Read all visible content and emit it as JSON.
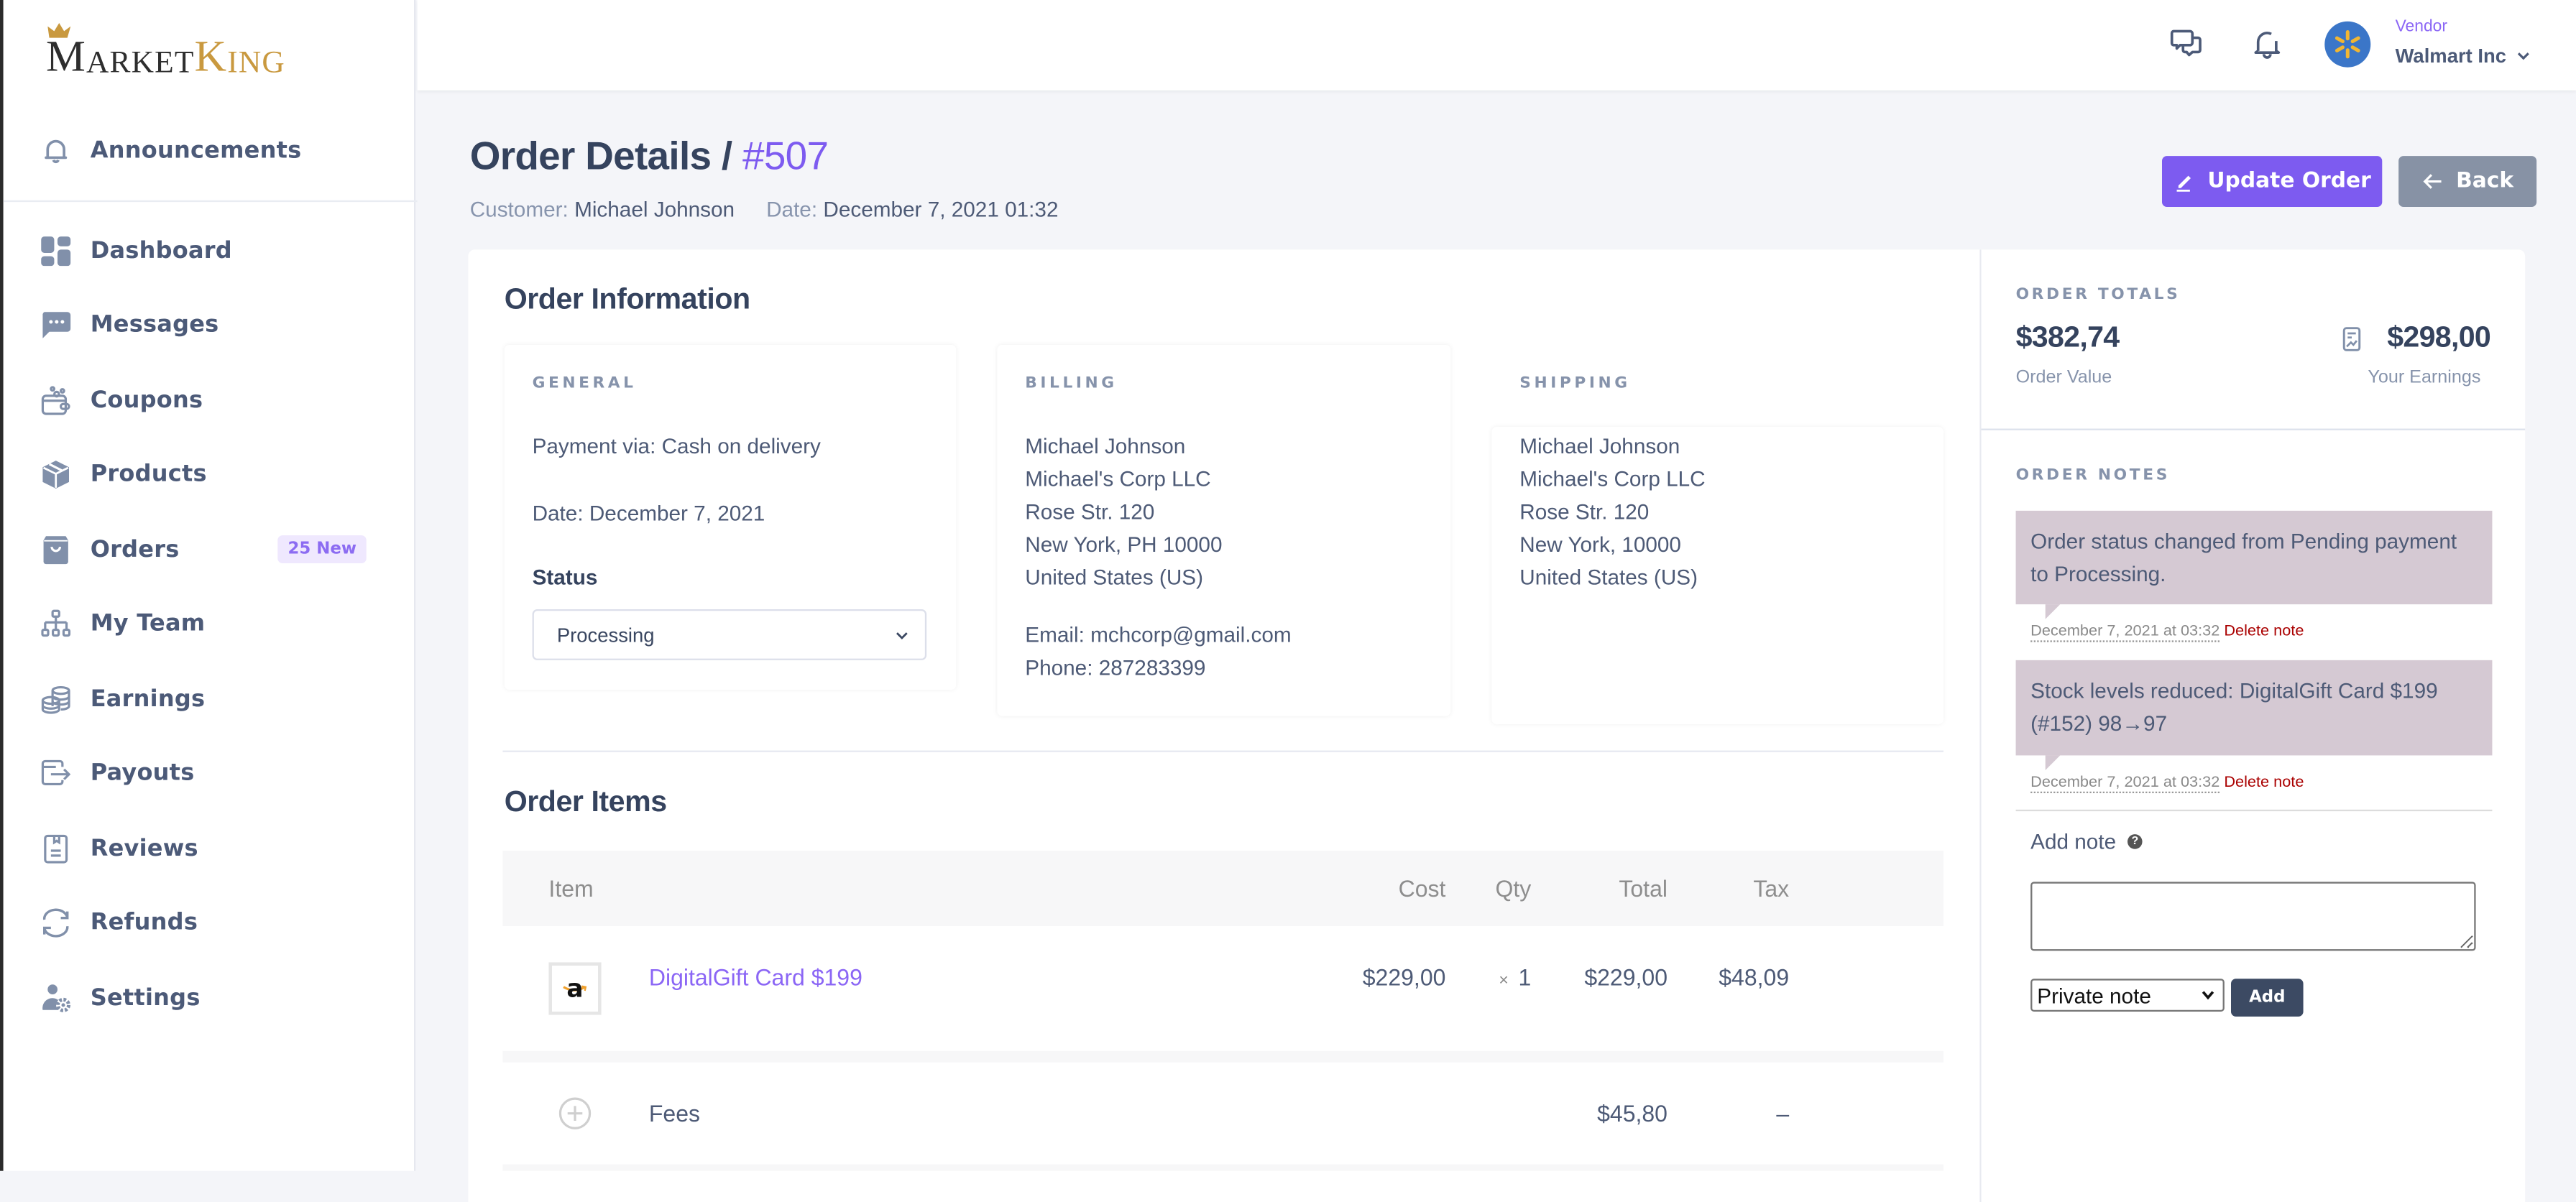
{
  "brand": {
    "logo_part1": "M",
    "logo_part2": "ARKET",
    "logo_part3": "K",
    "logo_part4": "ING"
  },
  "sidebar": {
    "announcements": {
      "label": "Announcements",
      "icon": "bell-icon"
    },
    "items": [
      {
        "label": "Dashboard",
        "icon": "dashboard-grid-icon"
      },
      {
        "label": "Messages",
        "icon": "chat-bubble-icon"
      },
      {
        "label": "Coupons",
        "icon": "coupon-wallet-icon"
      },
      {
        "label": "Products",
        "icon": "box-icon"
      },
      {
        "label": "Orders",
        "icon": "shopping-bag-icon",
        "badge": "25 New"
      },
      {
        "label": "My Team",
        "icon": "org-chart-icon"
      },
      {
        "label": "Earnings",
        "icon": "coins-icon"
      },
      {
        "label": "Payouts",
        "icon": "payout-arrow-icon"
      },
      {
        "label": "Reviews",
        "icon": "review-document-icon"
      },
      {
        "label": "Refunds",
        "icon": "refresh-icon"
      },
      {
        "label": "Settings",
        "icon": "user-gear-icon"
      }
    ]
  },
  "topbar": {
    "vendor_role": "Vendor",
    "vendor_name": "Walmart Inc"
  },
  "page": {
    "title": "Order Details /",
    "order_number": "#507",
    "customer_label": "Customer:",
    "customer_name": "Michael Johnson",
    "date_label": "Date:",
    "date_value": "December 7, 2021 01:32",
    "update_button": "Update Order",
    "back_button": "Back"
  },
  "order_information": {
    "heading": "Order Information",
    "general": {
      "title": "GENERAL",
      "payment": "Payment via: Cash on delivery",
      "date": "Date: December 7, 2021",
      "status_label": "Status",
      "status_value": "Processing"
    },
    "billing": {
      "title": "BILLING",
      "lines": [
        "Michael Johnson",
        "Michael's Corp LLC",
        "Rose Str. 120",
        "New York, PH 10000",
        "United States (US)"
      ],
      "email": "Email: mchcorp@gmail.com",
      "phone": "Phone: 287283399"
    },
    "shipping": {
      "title": "SHIPPING",
      "lines": [
        "Michael Johnson",
        "Michael's Corp LLC",
        "Rose Str. 120",
        "New York, 10000",
        "United States (US)"
      ]
    }
  },
  "order_items": {
    "heading": "Order Items",
    "columns": {
      "item": "Item",
      "cost": "Cost",
      "qty": "Qty",
      "total": "Total",
      "tax": "Tax"
    },
    "rows": [
      {
        "name": "DigitalGift Card $199",
        "cost": "$229,00",
        "qty_prefix": "×",
        "qty": "1",
        "total": "$229,00",
        "tax": "$48,09",
        "thumb": "a"
      }
    ],
    "fees": {
      "label": "Fees",
      "total": "$45,80",
      "tax": "–"
    }
  },
  "totals": {
    "title": "ORDER TOTALS",
    "order_value": "$382,74",
    "order_value_label": "Order Value",
    "earnings": "$298,00",
    "earnings_label": "Your Earnings"
  },
  "notes": {
    "title": "ORDER NOTES",
    "items": [
      {
        "text": "Order status changed from Pending payment to Processing.",
        "date": "December 7, 2021 at 03:32",
        "delete": "Delete note"
      },
      {
        "text": "Stock levels reduced: DigitalGift Card $199 (#152) 98→97",
        "date": "December 7, 2021 at 03:32",
        "delete": "Delete note"
      }
    ],
    "add_label": "Add note",
    "help": "?",
    "note_input_value": "",
    "note_type": "Private note",
    "add_button": "Add"
  },
  "colors": {
    "accent": "#7d5bf0",
    "text": "#35435e",
    "muted": "#8693ab",
    "note_bg": "#d5c9d3",
    "delete": "#aa0000"
  }
}
